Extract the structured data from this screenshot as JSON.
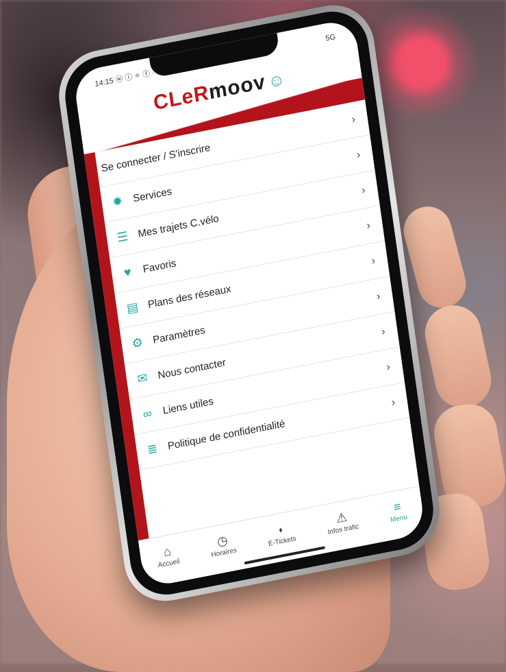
{
  "status_bar": {
    "time": "14:15",
    "left_icons": "ⓦ ⓘ ✧ ⓕ ·",
    "right_text": "5G"
  },
  "logo": {
    "part1": "CLeR",
    "part2": "moov"
  },
  "menu": {
    "items": [
      {
        "label": "Se connecter / S'inscrire",
        "icon": ""
      },
      {
        "label": "Services",
        "icon": "✹"
      },
      {
        "label": "Mes trajets C.vélo",
        "icon": "☰"
      },
      {
        "label": "Favoris",
        "icon": "♥"
      },
      {
        "label": "Plans des réseaux",
        "icon": "▤"
      },
      {
        "label": "Paramètres",
        "icon": "⚙"
      },
      {
        "label": "Nous contacter",
        "icon": "✉"
      },
      {
        "label": "Liens utiles",
        "icon": "∞"
      },
      {
        "label": "Politique de confidentialité",
        "icon": "≣"
      }
    ],
    "chevron": "›"
  },
  "tabbar": {
    "tabs": [
      {
        "label": "Accueil",
        "icon": "⌂"
      },
      {
        "label": "Horaires",
        "icon": "◷"
      },
      {
        "label": "E-Tickets",
        "icon": "⬪"
      },
      {
        "label": "Infos trafic",
        "icon": "⚠"
      },
      {
        "label": "Menu",
        "icon": "≡"
      }
    ]
  },
  "colors": {
    "accent": "#2aa6a0",
    "brand_red": "#b3141b"
  }
}
